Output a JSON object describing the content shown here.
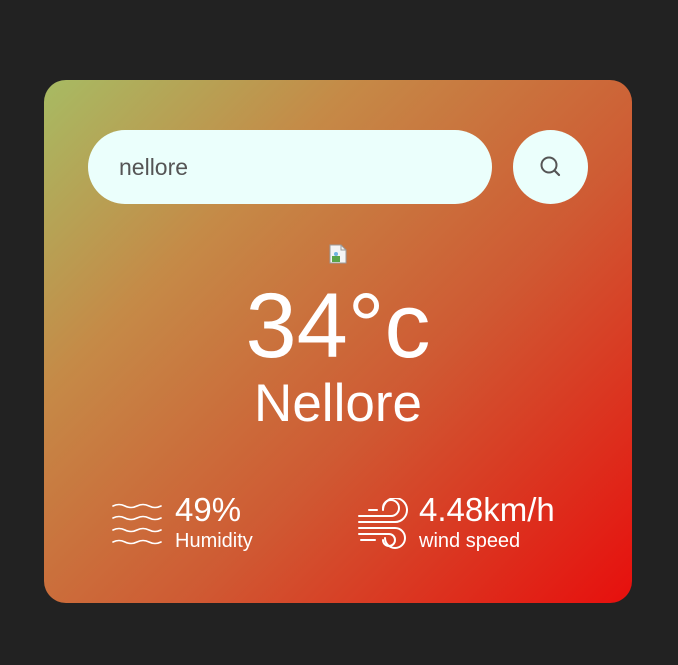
{
  "search": {
    "value": "nellore",
    "icon": "search-icon"
  },
  "weather": {
    "icon": "weather-icon",
    "temperature": "34°c",
    "city": "Nellore"
  },
  "humidity": {
    "icon": "humidity-waves-icon",
    "value": "49%",
    "label": "Humidity"
  },
  "wind": {
    "icon": "wind-icon",
    "value": "4.48km/h",
    "label": "wind speed"
  },
  "colors": {
    "background": "#222222",
    "gradient_start": "#a7bb63",
    "gradient_end": "#e70f0d",
    "input_background": "#ebfffc",
    "text": "#ffffff"
  }
}
